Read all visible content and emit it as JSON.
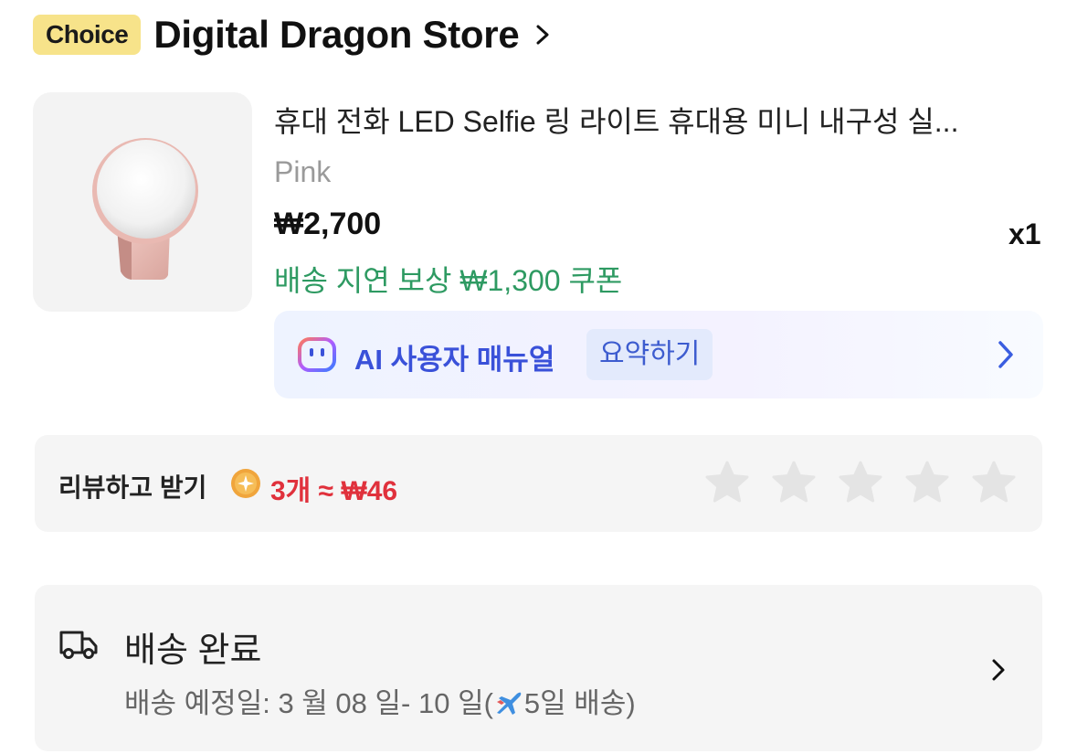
{
  "store": {
    "badge": "Choice",
    "name": "Digital Dragon Store"
  },
  "product": {
    "title": "휴대 전화 LED Selfie 링 라이트 휴대용 미니 내구성 실...",
    "variant": "Pink",
    "price": "₩2,700",
    "quantity": "x1",
    "coupon": "배송 지연 보상 ₩1,300 쿠폰"
  },
  "ai_manual": {
    "label": "AI 사용자 매뉴얼",
    "summary_button": "요약하기"
  },
  "review": {
    "label": "리뷰하고 받기",
    "reward": "3개 ≈ ₩46",
    "rating": 0,
    "max_rating": 5
  },
  "delivery": {
    "status": "배송 완료",
    "estimate_prefix": "배송 예정일: 3 월 08 일- 10 일(",
    "estimate_suffix": "5일 배송)"
  },
  "colors": {
    "choice_badge": "#f7e38a",
    "coupon_green": "#2e9a62",
    "ai_blue": "#3a51d9",
    "reward_red": "#e0313c"
  },
  "icons": [
    "chevron-right-icon",
    "ai-bot-icon",
    "coin-icon",
    "star-icon",
    "truck-icon",
    "airplane-icon"
  ]
}
